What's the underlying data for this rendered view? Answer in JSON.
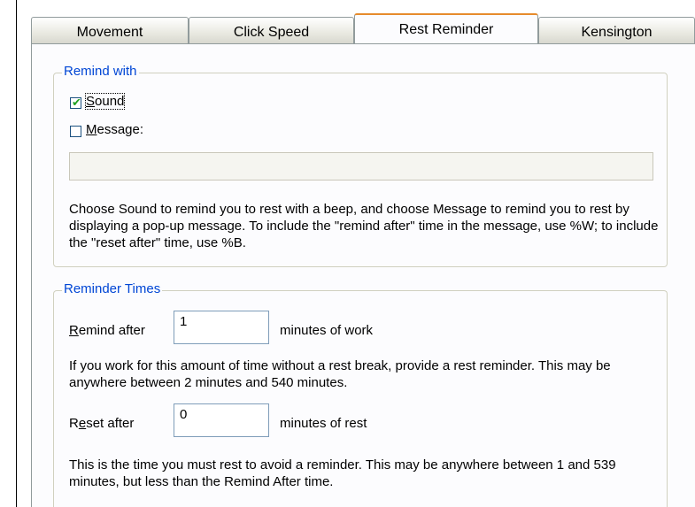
{
  "tabs": [
    "Movement",
    "Click Speed",
    "Rest Reminder",
    "Kensington"
  ],
  "remind_with": {
    "title": "Remind with",
    "sound_label_pre": "",
    "sound_label_u": "S",
    "sound_label_post": "ound",
    "sound_checked": true,
    "message_label_u": "M",
    "message_label_post": "essage:",
    "message_checked": false,
    "message_value": "",
    "description": "Choose Sound to remind you to rest with a beep, and choose Message to remind you to rest by displaying a pop-up message. To include the \"remind after\" time in the message, use %W; to include the \"reset after\" time, use %B."
  },
  "reminder_times": {
    "title": "Reminder Times",
    "remind_after_u": "R",
    "remind_after_post": "emind after",
    "remind_after_value": "1",
    "remind_after_units": "minutes of work",
    "remind_desc": "If you work for this amount of time without a rest break, provide a rest reminder. This may be anywhere between 2 minutes and 540 minutes.",
    "reset_after_pre": "R",
    "reset_after_u": "e",
    "reset_after_post": "set after",
    "reset_after_value": "0",
    "reset_after_units": "minutes of rest",
    "reset_desc": "This is the time you must rest to avoid a reminder. This may be anywhere between 1 and 539 minutes, but less than the Remind After time."
  }
}
